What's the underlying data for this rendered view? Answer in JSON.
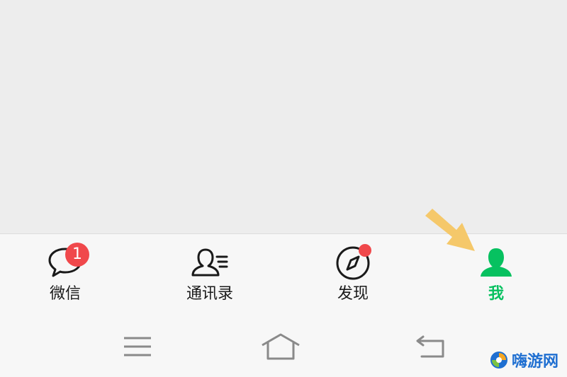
{
  "tabbar": {
    "tabs": [
      {
        "label": "微信",
        "badge": "1",
        "icon": "chat-bubble-icon"
      },
      {
        "label": "通讯录",
        "icon": "contacts-icon"
      },
      {
        "label": "发现",
        "icon": "compass-icon",
        "has_dot": true
      },
      {
        "label": "我",
        "icon": "person-icon",
        "active": true
      }
    ]
  },
  "navbar": {
    "buttons": [
      "menu-icon",
      "home-icon",
      "back-icon"
    ]
  },
  "watermark": {
    "text": "嗨游网"
  },
  "colors": {
    "active": "#07c160",
    "badge": "#f0484b",
    "arrow": "#f5c86a",
    "background": "#ededed",
    "tabbar": "#f7f7f7"
  }
}
